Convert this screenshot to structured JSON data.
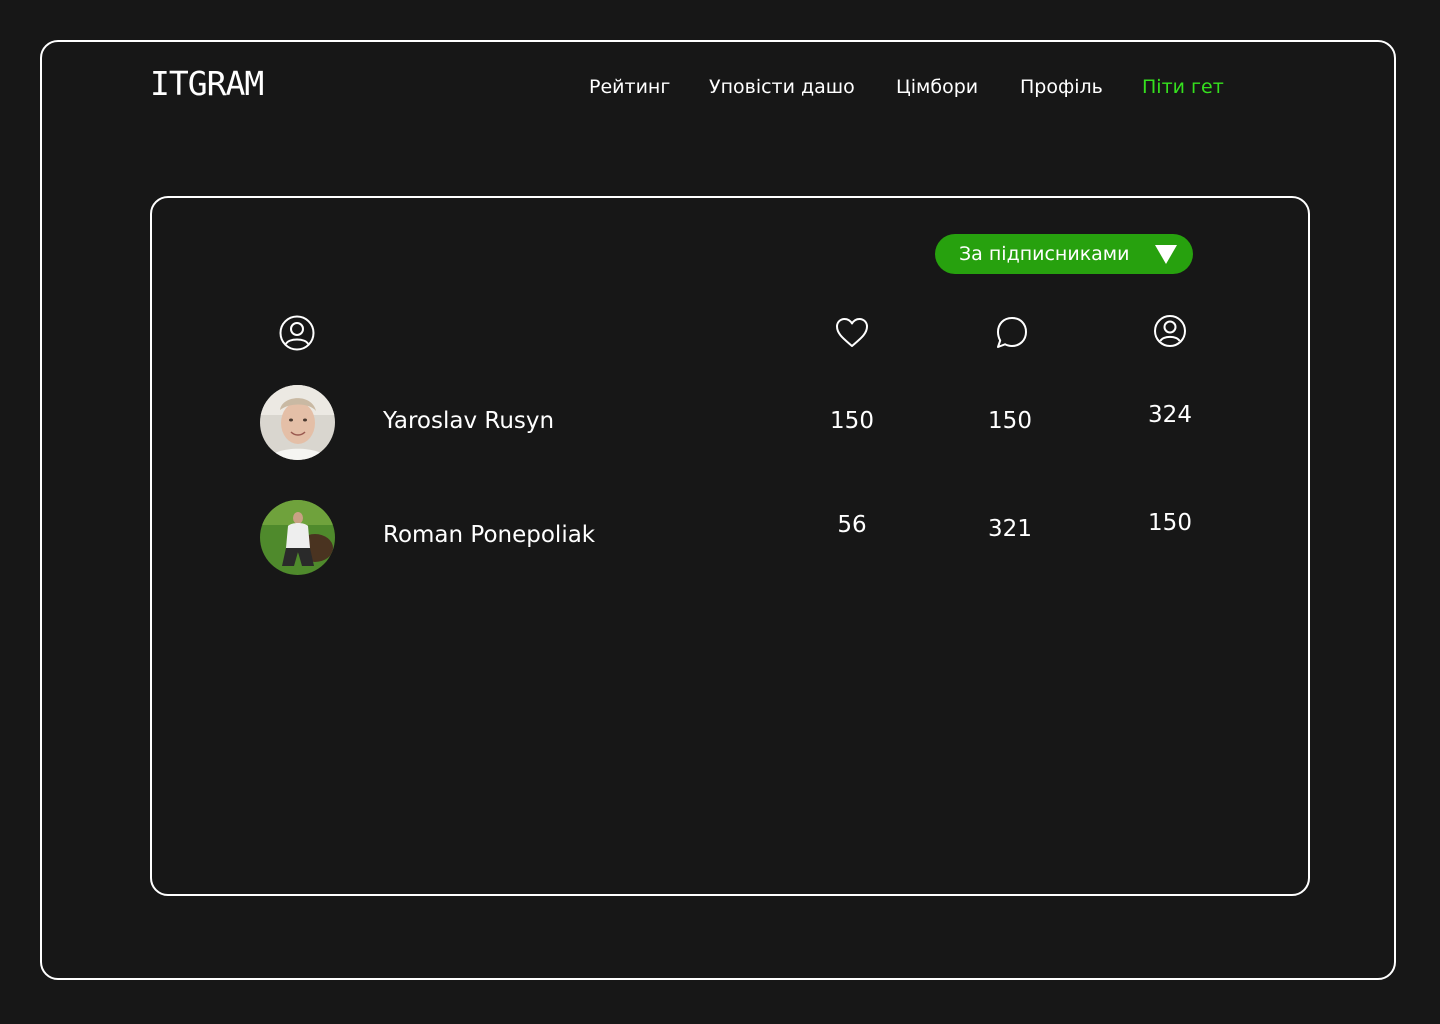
{
  "brand": {
    "logo": "ITGRAM"
  },
  "nav": {
    "items": [
      {
        "label": "Рейтинг"
      },
      {
        "label": "Уповісти дашо"
      },
      {
        "label": "Цімбори"
      },
      {
        "label": "Профіль"
      },
      {
        "label": "Піти гет",
        "active": true
      }
    ]
  },
  "sort": {
    "label": "За підписниками"
  },
  "table": {
    "columns": [
      {
        "icon": "user-icon"
      },
      {
        "icon": "heart-icon"
      },
      {
        "icon": "comment-icon"
      },
      {
        "icon": "followers-icon"
      }
    ],
    "rows": [
      {
        "name": "Yaroslav Rusyn",
        "likes": "150",
        "comments": "150",
        "followers": "324"
      },
      {
        "name": "Roman Ponepoliak",
        "likes": "56",
        "comments": "321",
        "followers": "150"
      }
    ]
  },
  "colors": {
    "background": "#171717",
    "accent_green": "#27a10e",
    "active_nav": "#35e01e",
    "text": "#ffffff"
  }
}
